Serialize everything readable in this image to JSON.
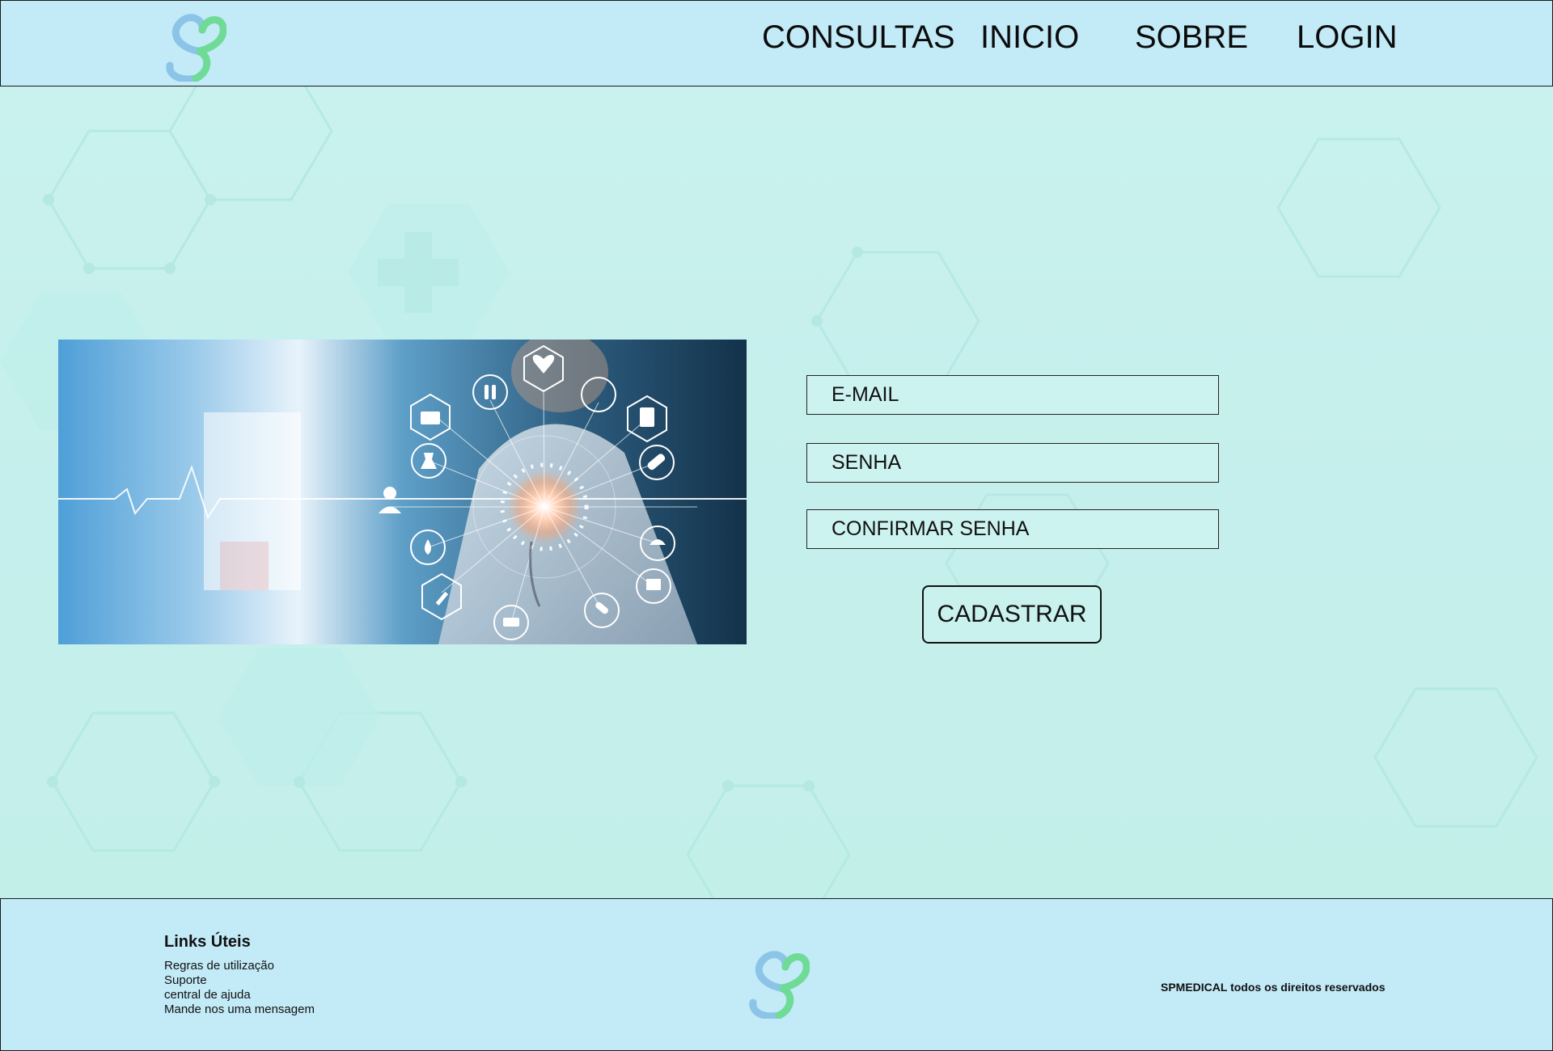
{
  "header": {
    "logo_icon": "heart-s-logo-icon",
    "nav": [
      {
        "label": "CONSULTAS"
      },
      {
        "label": "INICIO"
      },
      {
        "label": "SOBRE"
      },
      {
        "label": "LOGIN"
      }
    ]
  },
  "hero": {
    "image_icons": [
      "heart-pulse-icon",
      "test-tubes-icon",
      "syringe-icon",
      "clipboard-icon",
      "medical-kit-icon",
      "flask-icon",
      "pills-icon",
      "doctor-icon",
      "blood-drop-icon",
      "nurse-cap-icon",
      "monitor-icon",
      "ambulance-icon",
      "capsule-icon"
    ]
  },
  "form": {
    "email_placeholder": "E-MAIL",
    "password_placeholder": "SENHA",
    "confirm_placeholder": "CONFIRMAR SENHA",
    "submit_label": "CADASTRAR"
  },
  "footer": {
    "title": "Links Úteis",
    "links": [
      {
        "label": "Regras de utilização"
      },
      {
        "label": "Suporte"
      },
      {
        "label": "central de ajuda"
      },
      {
        "label": "Mande nos uma mensagem"
      }
    ],
    "logo_icon": "heart-s-logo-icon",
    "copyright": "SPMEDICAL todos os direitos reservados"
  },
  "colors": {
    "header_bg": "#c2eaf7",
    "page_bg": "#c6f0ee",
    "logo_blue": "#8cc4e8",
    "logo_green": "#6fdb96"
  }
}
